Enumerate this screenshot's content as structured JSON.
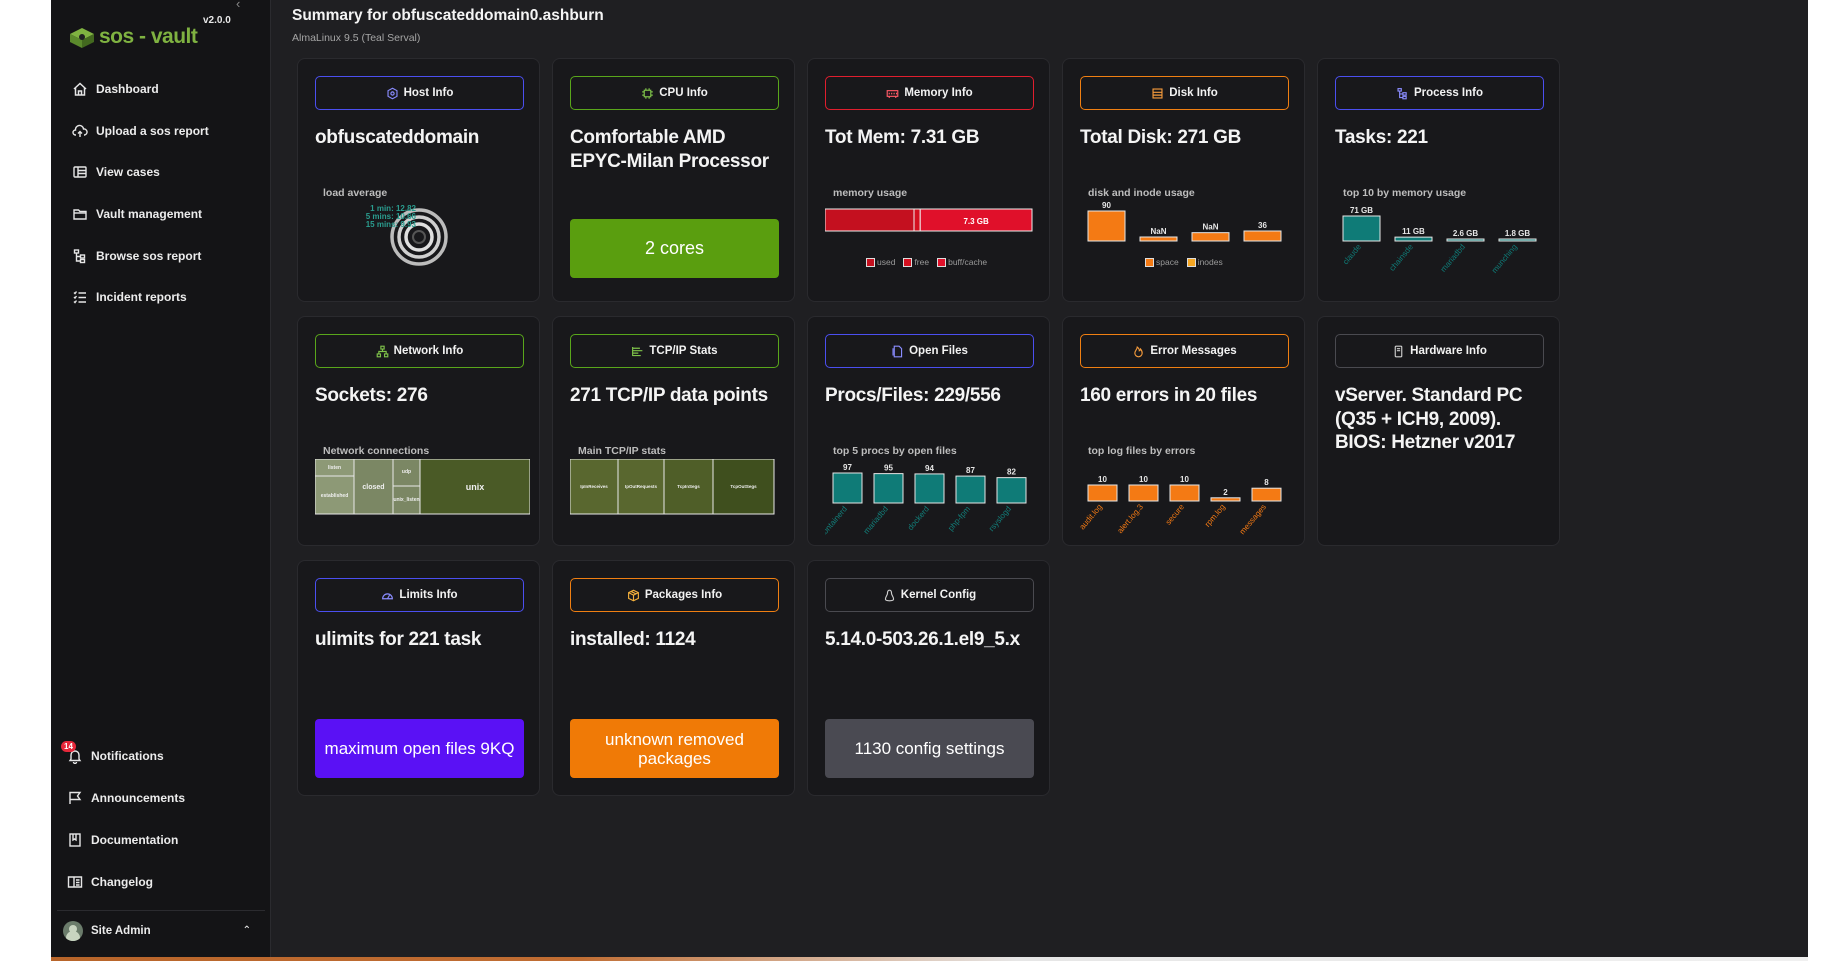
{
  "app": {
    "name": "sos - vault",
    "version": "v2.0.0",
    "brand_color": "#7fb241"
  },
  "sidebar": {
    "collapse_icon": "chevron-left-icon",
    "items": [
      {
        "label": "Dashboard",
        "icon": "home-icon"
      },
      {
        "label": "Upload a sos report",
        "icon": "cloud-upload-icon"
      },
      {
        "label": "View cases",
        "icon": "cases-icon"
      },
      {
        "label": "Vault management",
        "icon": "folder-icon"
      },
      {
        "label": "Browse sos report",
        "icon": "tree-icon"
      },
      {
        "label": "Incident reports",
        "icon": "list-check-icon"
      }
    ],
    "bottom_items": [
      {
        "label": "Notifications",
        "icon": "bell-icon",
        "badge": "14"
      },
      {
        "label": "Announcements",
        "icon": "flag-icon"
      },
      {
        "label": "Documentation",
        "icon": "book-icon"
      },
      {
        "label": "Changelog",
        "icon": "changelog-icon"
      }
    ],
    "user": {
      "name": "Site Admin",
      "icon": "chevron-up-icon"
    }
  },
  "header": {
    "title": "Summary for obfuscateddomain0.ashburn",
    "subtitle": "AlmaLinux 9.5 (Teal Serval)"
  },
  "cards": {
    "host": {
      "tag": "Host Info",
      "color": "#4b4ff0",
      "value": "obfuscateddomain",
      "caption": "load average",
      "load": [
        {
          "label": "1 min:",
          "value": "12.82"
        },
        {
          "label": "5 mins:",
          "value": "10.66"
        },
        {
          "label": "15 mins:",
          "value": "9.93"
        }
      ]
    },
    "cpu": {
      "tag": "CPU Info",
      "color": "#59a61b",
      "value": "Comfortable AMD EPYC-Milan Processor",
      "cta": "2 cores"
    },
    "memory": {
      "tag": "Memory Info",
      "color": "#e01e2e",
      "value": "Tot Mem: 7.31 GB",
      "caption": "memory usage",
      "bar_label": "7.3 GB",
      "legend": [
        "used",
        "free",
        "buff/cache"
      ],
      "shares": {
        "used": 0.43,
        "free": 0.03,
        "buffcache": 0.54
      }
    },
    "disk": {
      "tag": "Disk Info",
      "color": "#f07f12",
      "value": "Total Disk: 271 GB",
      "caption": "disk and inode usage",
      "bars": [
        {
          "label": "90",
          "value": 90
        },
        {
          "label": "NaN",
          "value": 5
        },
        {
          "label": "NaN",
          "value": 25
        },
        {
          "label": "36",
          "value": 30
        }
      ],
      "legend": [
        "space",
        "inodes"
      ]
    },
    "process": {
      "tag": "Process Info",
      "color": "#4b4ff0",
      "value": "Tasks: 221",
      "caption": "top 10 by memory usage",
      "bars": [
        {
          "name": "claude",
          "label": "71 GB",
          "value": 71
        },
        {
          "name": "chainsde",
          "label": "11 GB",
          "value": 11
        },
        {
          "name": "mariadbd",
          "label": "2.6 GB",
          "value": 2.6
        },
        {
          "name": "munching",
          "label": "1.8 GB",
          "value": 1.8
        }
      ]
    },
    "network": {
      "tag": "Network Info",
      "color": "#59a61b",
      "value": "Sockets: 276",
      "caption": "Network connections",
      "cells": [
        "listen",
        "established",
        "closed",
        "udp",
        "unix_listen",
        "unix"
      ]
    },
    "tcpip": {
      "tag": "TCP/IP Stats",
      "color": "#59a61b",
      "value": "271 TCP/IP data points",
      "caption": "Main TCP/IP stats",
      "cells": [
        "IpInReceives",
        "IpOutRequests",
        "TcpInSegs",
        "TcpOutSegs"
      ]
    },
    "openfiles": {
      "tag": "Open Files",
      "color": "#4b4ff0",
      "value": "Procs/Files: 229/556",
      "caption": "top 5 procs by open files",
      "bars": [
        {
          "name": "containerd",
          "label": "97",
          "value": 97
        },
        {
          "name": "mariadbd",
          "label": "95",
          "value": 95
        },
        {
          "name": "dockerd",
          "label": "94",
          "value": 94
        },
        {
          "name": "php-fpm",
          "label": "87",
          "value": 87
        },
        {
          "name": "rsyslogd",
          "label": "82",
          "value": 82
        }
      ]
    },
    "errors": {
      "tag": "Error Messages",
      "color": "#f07f12",
      "value": "160 errors in 20 files",
      "caption": "top log files by errors",
      "bars": [
        {
          "name": "audit.log",
          "label": "10",
          "value": 10
        },
        {
          "name": "alert.log.3",
          "label": "10",
          "value": 10
        },
        {
          "name": "secure",
          "label": "10",
          "value": 10
        },
        {
          "name": "rpm.log",
          "label": "2",
          "value": 2
        },
        {
          "name": "messages",
          "label": "8",
          "value": 8
        }
      ]
    },
    "hardware": {
      "tag": "Hardware Info",
      "color": "#4a4a50",
      "value": "vServer. Standard PC (Q35 + ICH9, 2009). BIOS: Hetzner v2017"
    },
    "limits": {
      "tag": "Limits Info",
      "color": "#4b4ff0",
      "value": "ulimits for 221 task",
      "cta": "maximum open files 9KQ"
    },
    "packages": {
      "tag": "Packages Info",
      "color": "#f07f12",
      "value": "installed: 1124",
      "cta": "unknown removed packages"
    },
    "kernel": {
      "tag": "Kernel Config",
      "color": "#4a4a50",
      "value": "5.14.0-503.26.1.el9_5.x",
      "cta": "1130 config settings"
    }
  }
}
